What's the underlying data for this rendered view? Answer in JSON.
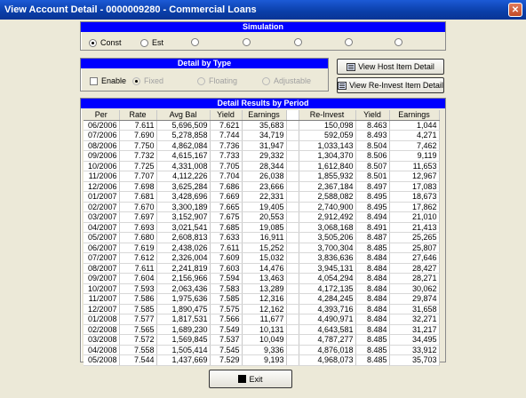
{
  "window": {
    "title": "View Account Detail - 0000009280 - Commercial Loans",
    "close_glyph": "✕"
  },
  "simulation": {
    "header": "Simulation",
    "options": [
      {
        "label": "Const",
        "selected": true
      },
      {
        "label": "Est",
        "selected": false
      },
      {
        "label": "",
        "selected": false
      },
      {
        "label": "",
        "selected": false
      },
      {
        "label": "",
        "selected": false
      },
      {
        "label": "",
        "selected": false
      },
      {
        "label": "",
        "selected": false
      }
    ]
  },
  "detail_by_type": {
    "header": "Detail by Type",
    "enable_label": "Enable",
    "enable_checked": false,
    "options": [
      {
        "label": "Fixed",
        "selected": true
      },
      {
        "label": "Floating",
        "selected": false
      },
      {
        "label": "Adjustable",
        "selected": false
      }
    ]
  },
  "buttons": {
    "view_host_item_detail": "View Host Item Detail",
    "view_reinvest_item_detail": "View Re-Invest Item Detail",
    "exit": "Exit"
  },
  "results": {
    "header": "Detail Results by Period",
    "columns": [
      "Per",
      "Rate",
      "Avg Bal",
      "Yield",
      "Earnings",
      "",
      "Re-Invest",
      "Yield",
      "Earnings"
    ],
    "rows": [
      [
        "06/2006",
        "7.611",
        "5,696,509",
        "7.621",
        "35,683",
        "",
        "150,098",
        "8.463",
        "1,044"
      ],
      [
        "07/2006",
        "7.690",
        "5,278,858",
        "7.744",
        "34,719",
        "",
        "592,059",
        "8.493",
        "4,271"
      ],
      [
        "08/2006",
        "7.750",
        "4,862,084",
        "7.736",
        "31,947",
        "",
        "1,033,143",
        "8.504",
        "7,462"
      ],
      [
        "09/2006",
        "7.732",
        "4,615,167",
        "7.733",
        "29,332",
        "",
        "1,304,370",
        "8.506",
        "9,119"
      ],
      [
        "10/2006",
        "7.725",
        "4,331,008",
        "7.705",
        "28,344",
        "",
        "1,612,840",
        "8.507",
        "11,653"
      ],
      [
        "11/2006",
        "7.707",
        "4,112,226",
        "7.704",
        "26,038",
        "",
        "1,855,932",
        "8.501",
        "12,967"
      ],
      [
        "12/2006",
        "7.698",
        "3,625,284",
        "7.686",
        "23,666",
        "",
        "2,367,184",
        "8.497",
        "17,083"
      ],
      [
        "01/2007",
        "7.681",
        "3,428,696",
        "7.669",
        "22,331",
        "",
        "2,588,082",
        "8.495",
        "18,673"
      ],
      [
        "02/2007",
        "7.670",
        "3,300,189",
        "7.665",
        "19,405",
        "",
        "2,740,900",
        "8.495",
        "17,862"
      ],
      [
        "03/2007",
        "7.697",
        "3,152,907",
        "7.675",
        "20,553",
        "",
        "2,912,492",
        "8.494",
        "21,010"
      ],
      [
        "04/2007",
        "7.693",
        "3,021,541",
        "7.685",
        "19,085",
        "",
        "3,068,168",
        "8.491",
        "21,413"
      ],
      [
        "05/2007",
        "7.680",
        "2,608,813",
        "7.633",
        "16,911",
        "",
        "3,505,206",
        "8.487",
        "25,265"
      ],
      [
        "06/2007",
        "7.619",
        "2,438,026",
        "7.611",
        "15,252",
        "",
        "3,700,304",
        "8.485",
        "25,807"
      ],
      [
        "07/2007",
        "7.612",
        "2,326,004",
        "7.609",
        "15,032",
        "",
        "3,836,636",
        "8.484",
        "27,646"
      ],
      [
        "08/2007",
        "7.611",
        "2,241,819",
        "7.603",
        "14,476",
        "",
        "3,945,131",
        "8.484",
        "28,427"
      ],
      [
        "09/2007",
        "7.604",
        "2,156,966",
        "7.594",
        "13,463",
        "",
        "4,054,294",
        "8.484",
        "28,271"
      ],
      [
        "10/2007",
        "7.593",
        "2,063,436",
        "7.583",
        "13,289",
        "",
        "4,172,135",
        "8.484",
        "30,062"
      ],
      [
        "11/2007",
        "7.586",
        "1,975,636",
        "7.585",
        "12,316",
        "",
        "4,284,245",
        "8.484",
        "29,874"
      ],
      [
        "12/2007",
        "7.585",
        "1,890,475",
        "7.575",
        "12,162",
        "",
        "4,393,716",
        "8.484",
        "31,658"
      ],
      [
        "01/2008",
        "7.577",
        "1,817,531",
        "7.566",
        "11,677",
        "",
        "4,490,971",
        "8.484",
        "32,271"
      ],
      [
        "02/2008",
        "7.565",
        "1,689,230",
        "7.549",
        "10,131",
        "",
        "4,643,581",
        "8.484",
        "31,217"
      ],
      [
        "03/2008",
        "7.572",
        "1,569,845",
        "7.537",
        "10,049",
        "",
        "4,787,277",
        "8.485",
        "34,495"
      ],
      [
        "04/2008",
        "7.558",
        "1,505,414",
        "7.545",
        "9,336",
        "",
        "4,876,018",
        "8.485",
        "33,912"
      ],
      [
        "05/2008",
        "7.544",
        "1,437,669",
        "7.529",
        "9,193",
        "",
        "4,968,073",
        "8.485",
        "35,703"
      ]
    ]
  }
}
